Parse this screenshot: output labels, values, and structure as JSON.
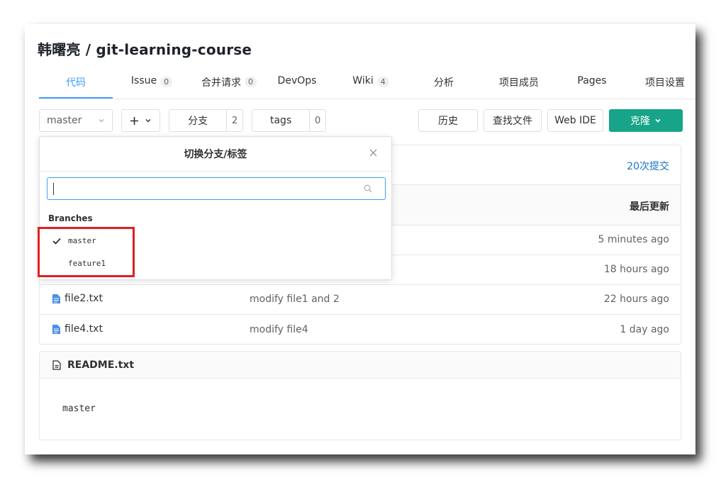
{
  "repo": {
    "title": "韩曙亮 / git-learning-course"
  },
  "tabs": [
    {
      "label": "代码",
      "active": true
    },
    {
      "label": "Issue",
      "badge": "0"
    },
    {
      "label": "合并请求",
      "badge": "0"
    },
    {
      "label": "DevOps"
    },
    {
      "label": "Wiki",
      "badge": "4"
    },
    {
      "label": "分析"
    },
    {
      "label": "项目成员"
    },
    {
      "label": "Pages"
    },
    {
      "label": "项目设置"
    }
  ],
  "toolbar": {
    "branch_select": "master",
    "branches_label": "分支",
    "branches_count": "2",
    "tags_label": "tags",
    "tags_count": "0",
    "history": "历史",
    "find_file": "查找文件",
    "web_ide": "Web IDE",
    "clone": "克隆"
  },
  "commits": {
    "label": "20次提交"
  },
  "table": {
    "last_updated_header": "最后更新",
    "rows": [
      {
        "name": "",
        "message": "",
        "date": "5 minutes ago"
      },
      {
        "name": "",
        "message": "",
        "date": "18 hours ago"
      },
      {
        "name": "file2.txt",
        "message": "modify file1 and 2",
        "date": "22 hours ago"
      },
      {
        "name": "file4.txt",
        "message": "modify file4",
        "date": "1 day ago"
      }
    ]
  },
  "readme": {
    "title": "README.txt",
    "content": "master"
  },
  "dropdown": {
    "title": "切换分支/标签",
    "search_value": "",
    "section": "Branches",
    "items": [
      {
        "label": "master",
        "selected": true
      },
      {
        "label": "feature1",
        "selected": false
      }
    ]
  },
  "colors": {
    "accent": "#409eff",
    "clone_button": "#17a488",
    "highlight": "#e02020"
  }
}
